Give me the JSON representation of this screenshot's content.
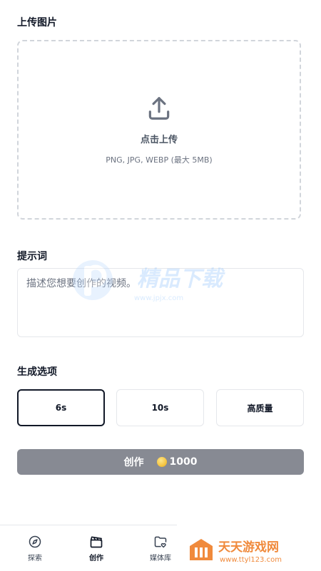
{
  "upload": {
    "section_title": "上传图片",
    "title": "点击上传",
    "hint": "PNG, JPG, WEBP (最大 5MB)"
  },
  "prompt": {
    "section_title": "提示词",
    "placeholder": "描述您想要创作的视频。"
  },
  "options": {
    "section_title": "生成选项",
    "items": [
      {
        "label": "6s",
        "selected": true
      },
      {
        "label": "10s",
        "selected": false
      },
      {
        "label": "高质量",
        "selected": false
      }
    ]
  },
  "create": {
    "label": "创作",
    "cost": "1000",
    "icon": "coin-icon"
  },
  "nav": {
    "items": [
      {
        "label": "探索",
        "icon": "compass-icon",
        "active": false
      },
      {
        "label": "创作",
        "icon": "clapperboard-icon",
        "active": true
      },
      {
        "label": "媒体库",
        "icon": "folder-heart-icon",
        "active": false
      }
    ]
  },
  "watermarks": {
    "center_text": "精品下载",
    "center_url": "www.jpjx.com",
    "corner_text": "天天游戏网",
    "corner_url": "www.ttyl123.com"
  },
  "colors": {
    "accent_dark": "#111827",
    "button_disabled": "#878a93",
    "border": "#e5e7eb",
    "watermark_blue": "#3b82f6",
    "watermark_orange": "#f08a3c"
  }
}
